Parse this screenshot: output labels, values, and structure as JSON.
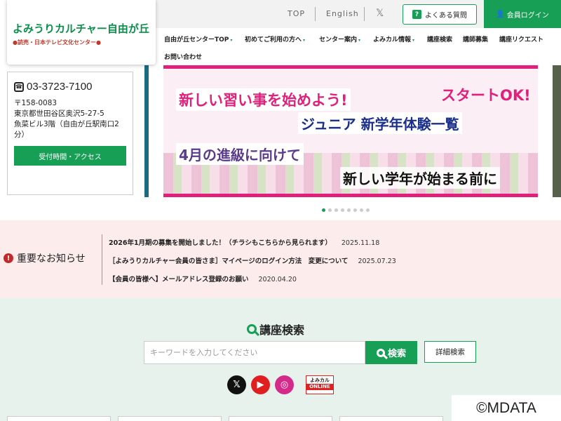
{
  "header": {
    "logo_main": "よみうりカルチャー自由が丘",
    "logo_sub": "●読売・日本テレビ文化センター●",
    "top_link": "TOP",
    "english_link": "English",
    "x_icon": "𝕏",
    "faq_label": "よくある質問",
    "login_label": "会員ログイン"
  },
  "nav": [
    {
      "label": "自由が丘センターTOP",
      "dropdown": true
    },
    {
      "label": "初めてご利用の方へ",
      "dropdown": true
    },
    {
      "label": "センター案内",
      "dropdown": true
    },
    {
      "label": "よみカル情報",
      "dropdown": true
    },
    {
      "label": "講座検索",
      "dropdown": false
    },
    {
      "label": "講師募集",
      "dropdown": false
    },
    {
      "label": "講座リクエスト",
      "dropdown": false
    },
    {
      "label": "お問い合わせ",
      "dropdown": false
    }
  ],
  "contact": {
    "phone": "03-3723-7100",
    "postal": "〒158-0083",
    "address_1": "東京都世田谷区奥沢5-27-5",
    "address_2": "魚菜ビル3階（自由が丘駅南口2分）",
    "access_button": "受付時間・アクセス"
  },
  "banner": {
    "line1": "新しい習い事を始めよう!",
    "line2": "スタートOK!",
    "line3": "ジュニア 新学年体験一覧",
    "line4": "4月の進級に向けて",
    "line5": "新しい学年が始まる前に"
  },
  "carousel": {
    "count": 8,
    "active": 0
  },
  "notices": {
    "heading": "重要なお知らせ",
    "items": [
      {
        "text": "2026年1月期の募集を開始しました！（チラシもこちらから見られます）",
        "date": "2025.11.18"
      },
      {
        "text": "［よみうりカルチャー会員の皆さま］マイページのログイン方法　変更について",
        "date": "2025.07.23"
      },
      {
        "text": "【会員の皆様へ】メールアドレス登録のお願い",
        "date": "2020.04.20"
      }
    ]
  },
  "search": {
    "title": "講座検索",
    "placeholder": "キーワードを入力してください",
    "button": "検索",
    "advanced": "詳細検索"
  },
  "social": {
    "x": "𝕏",
    "youtube": "▶",
    "instagram": "◎",
    "online_top": "よみカル",
    "online_bottom": "ONLINE"
  },
  "watermark": "©MDATA"
}
